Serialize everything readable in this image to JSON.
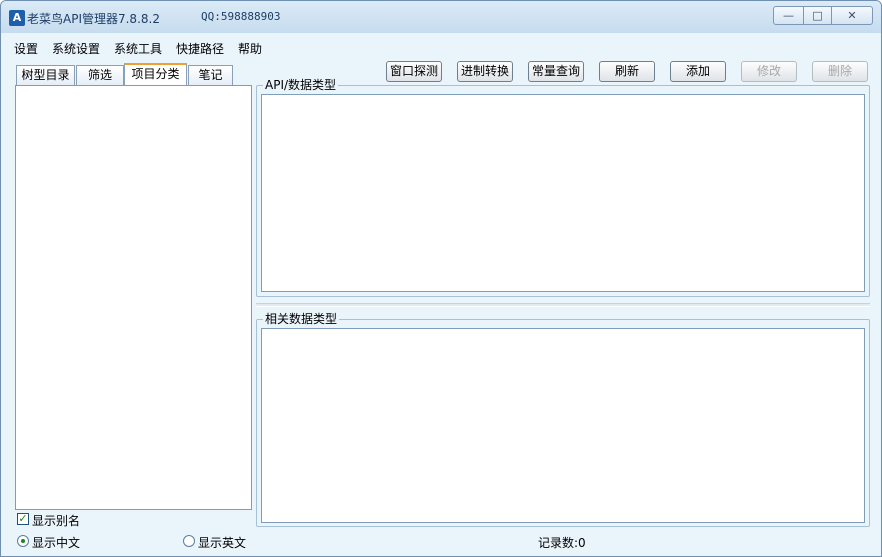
{
  "window": {
    "title": "老菜鸟API管理器7.8.8.2",
    "qq": "QQ:598888903",
    "logo_letter": "A",
    "minimize_glyph": "—",
    "maximize_glyph": "□",
    "close_glyph": "✕"
  },
  "menu": [
    "设置",
    "系统设置",
    "系统工具",
    "快捷路径",
    "帮助"
  ],
  "tabs": [
    {
      "label": "树型目录",
      "active": false
    },
    {
      "label": "筛选",
      "active": false
    },
    {
      "label": "项目分类",
      "active": true
    },
    {
      "label": "笔记",
      "active": false
    }
  ],
  "toolbar": [
    {
      "label": "窗口探测",
      "enabled": true
    },
    {
      "label": "进制转换",
      "enabled": true
    },
    {
      "label": "常量查询",
      "enabled": true
    },
    {
      "label": "刷新",
      "enabled": true
    },
    {
      "label": "添加",
      "enabled": true
    },
    {
      "label": "修改",
      "enabled": false
    },
    {
      "label": "删除",
      "enabled": false
    }
  ],
  "groups": {
    "api_types": "API/数据类型",
    "related_types": "相关数据类型"
  },
  "options": {
    "show_alias": {
      "label": "显示别名",
      "checked": true,
      "mark": "✓"
    },
    "show_chinese": {
      "label": "显示中文",
      "selected": true
    },
    "show_english": {
      "label": "显示英文",
      "selected": false
    }
  },
  "status": {
    "record_count": "记录数:0"
  },
  "colors": {
    "accent_tab": "#f0a030",
    "window_bg": "#eaf4fb",
    "check_mark": "#1a8a1a"
  }
}
